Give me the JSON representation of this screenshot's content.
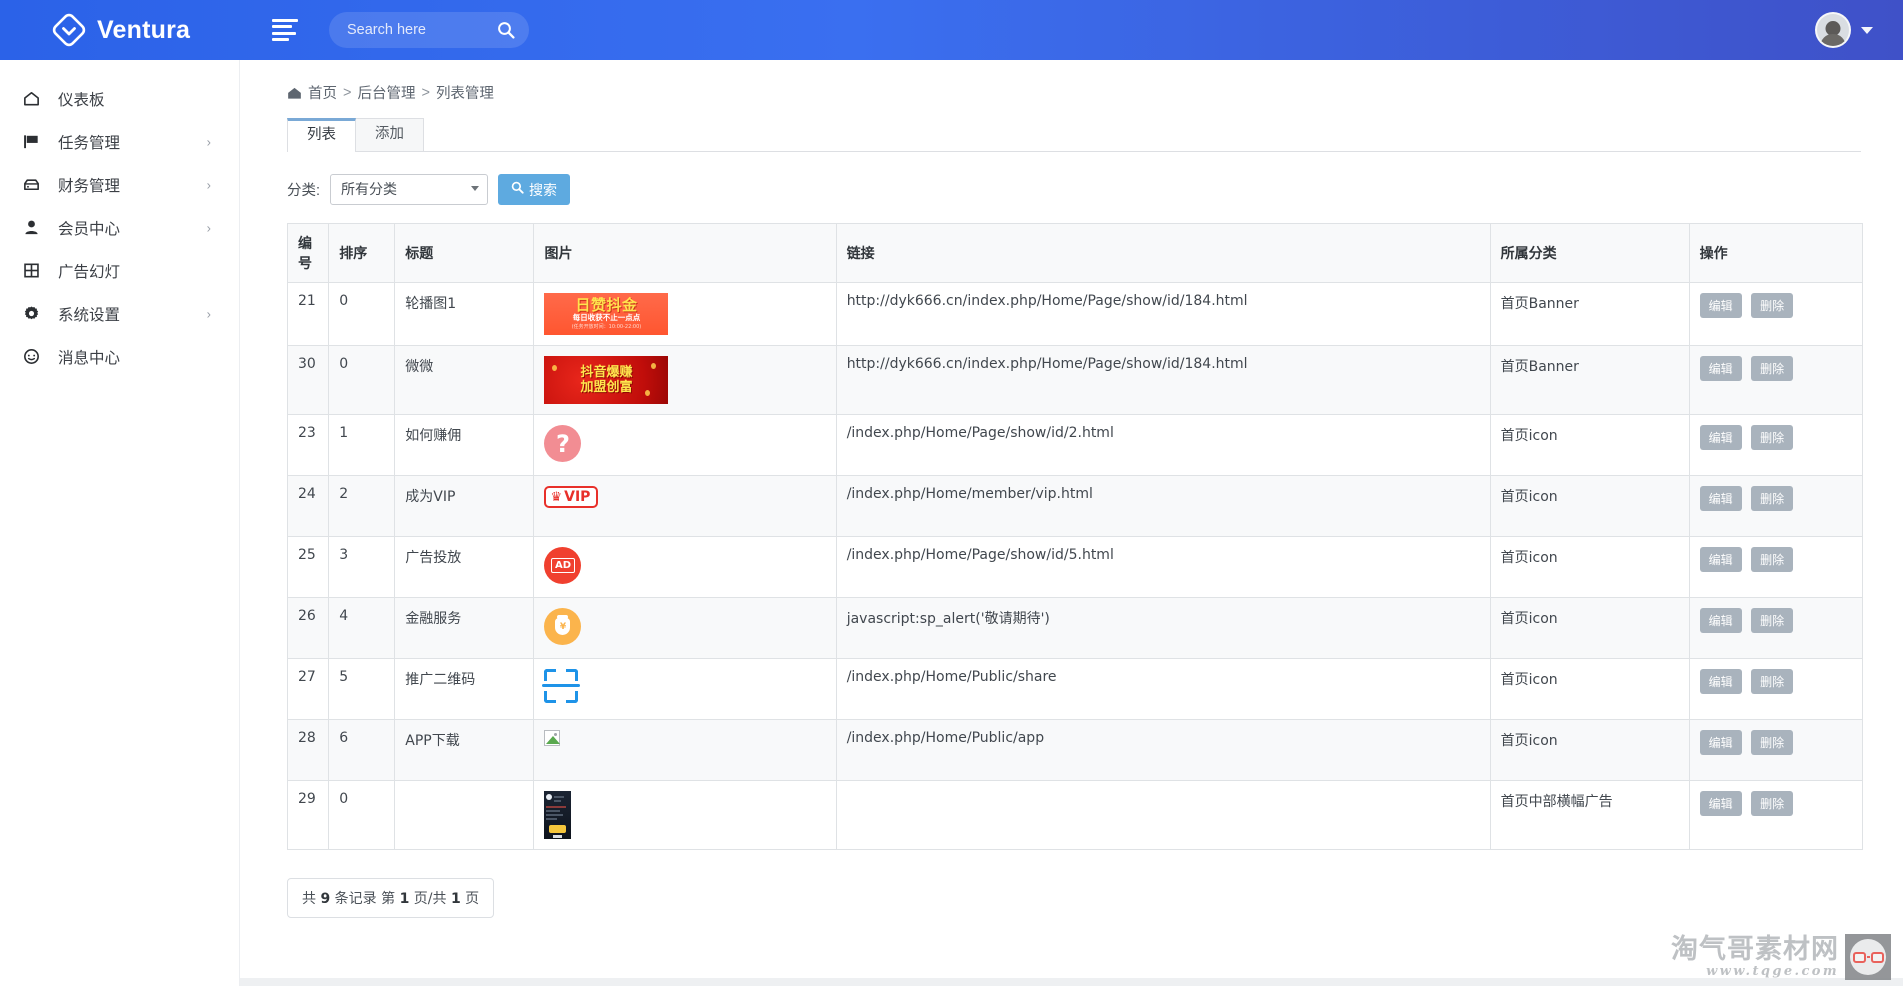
{
  "topbar": {
    "brand": "Ventura",
    "logo_icon": "diamond-chevron-logo",
    "menu_toggle_icon": "hamburger-icon",
    "search": {
      "placeholder": "Search here",
      "value": "",
      "icon": "search-icon"
    },
    "avatar_icon": "user-avatar",
    "caret_icon": "chevron-down-icon"
  },
  "sidebar": {
    "items": [
      {
        "label": "仪表板",
        "icon": "home-icon",
        "has_arrow": false
      },
      {
        "label": "任务管理",
        "icon": "flag-icon",
        "has_arrow": true
      },
      {
        "label": "财务管理",
        "icon": "drawer-icon",
        "has_arrow": true
      },
      {
        "label": "会员中心",
        "icon": "user-icon",
        "has_arrow": true
      },
      {
        "label": "广告幻灯",
        "icon": "grid-icon",
        "has_arrow": false
      },
      {
        "label": "系统设置",
        "icon": "gear-icon",
        "has_arrow": true
      },
      {
        "label": "消息中心",
        "icon": "chat-icon",
        "has_arrow": false
      }
    ]
  },
  "breadcrumb": {
    "home_icon": "home-icon",
    "items": [
      "首页",
      "后台管理",
      "列表管理"
    ],
    "separator": ">"
  },
  "tabs": [
    {
      "label": "列表",
      "active": true
    },
    {
      "label": "添加",
      "active": false
    }
  ],
  "filter": {
    "label": "分类:",
    "select_value": "所有分类",
    "select_options": [
      "所有分类"
    ],
    "search_button": "搜索",
    "search_button_icon": "search-icon"
  },
  "table": {
    "headers": [
      "编号",
      "排序",
      "标题",
      "图片",
      "链接",
      "所属分类",
      "操作"
    ],
    "actions": {
      "edit": "编辑",
      "delete": "删除"
    },
    "rows": [
      {
        "id": "21",
        "sort": "0",
        "title": "轮播图1",
        "image_kind": "banner-rizan-doujin",
        "image_text": {
          "line1": "日赞抖金",
          "line2": "每日收获不止一点点",
          "line3": "(任务开放时间：10:00-22:00)"
        },
        "link": "http://dyk666.cn/index.php/Home/Page/show/id/184.html",
        "category": "首页Banner"
      },
      {
        "id": "30",
        "sort": "0",
        "title": "微微",
        "image_kind": "banner-douyin-baozhuan",
        "image_text": {
          "line1": "抖音爆赚",
          "line2": "加盟创富",
          "line3": ""
        },
        "link": "http://dyk666.cn/index.php/Home/Page/show/id/184.html",
        "category": "首页Banner"
      },
      {
        "id": "23",
        "sort": "1",
        "title": "如何赚佣",
        "image_kind": "icon-question",
        "image_text": {
          "line1": "?",
          "line2": "",
          "line3": ""
        },
        "link": "/index.php/Home/Page/show/id/2.html",
        "category": "首页icon"
      },
      {
        "id": "24",
        "sort": "2",
        "title": "成为VIP",
        "image_kind": "icon-vip",
        "image_text": {
          "line1": "VIP",
          "line2": "",
          "line3": ""
        },
        "link": "/index.php/Home/member/vip.html",
        "category": "首页icon"
      },
      {
        "id": "25",
        "sort": "3",
        "title": "广告投放",
        "image_kind": "icon-ad",
        "image_text": {
          "line1": "AD",
          "line2": "",
          "line3": ""
        },
        "link": "/index.php/Home/Page/show/id/5.html",
        "category": "首页icon"
      },
      {
        "id": "26",
        "sort": "4",
        "title": "金融服务",
        "image_kind": "icon-moneybag",
        "image_text": {
          "line1": "¥",
          "line2": "",
          "line3": ""
        },
        "link": "javascript:sp_alert('敬请期待')",
        "category": "首页icon"
      },
      {
        "id": "27",
        "sort": "5",
        "title": "推广二维码",
        "image_kind": "icon-scan",
        "image_text": {
          "line1": "",
          "line2": "",
          "line3": ""
        },
        "link": "/index.php/Home/Public/share",
        "category": "首页icon"
      },
      {
        "id": "28",
        "sort": "6",
        "title": "APP下载",
        "image_kind": "icon-broken-image",
        "image_text": {
          "line1": "",
          "line2": "",
          "line3": ""
        },
        "link": "/index.php/Home/Public/app",
        "category": "首页icon"
      },
      {
        "id": "29",
        "sort": "0",
        "title": "",
        "image_kind": "thumb-phone-screenshot",
        "image_text": {
          "line1": "",
          "line2": "",
          "line3": ""
        },
        "link": "",
        "category": "首页中部横幅广告"
      }
    ]
  },
  "pagination": {
    "prefix": "共",
    "total": "9",
    "records_label": "条记录",
    "page_label": "第",
    "current_page": "1",
    "page_unit": "页/共",
    "total_pages": "1",
    "page_unit2": "页"
  },
  "watermark": {
    "title": "淘气哥素材网",
    "url": "www.tqge.com",
    "badge_icon": "glasses-face-icon"
  },
  "colors": {
    "topbar_blue": "#2b62e8",
    "tab_accent": "#7aa9d6",
    "search_button": "#5eaae0",
    "action_button": "#a9b3bd"
  }
}
